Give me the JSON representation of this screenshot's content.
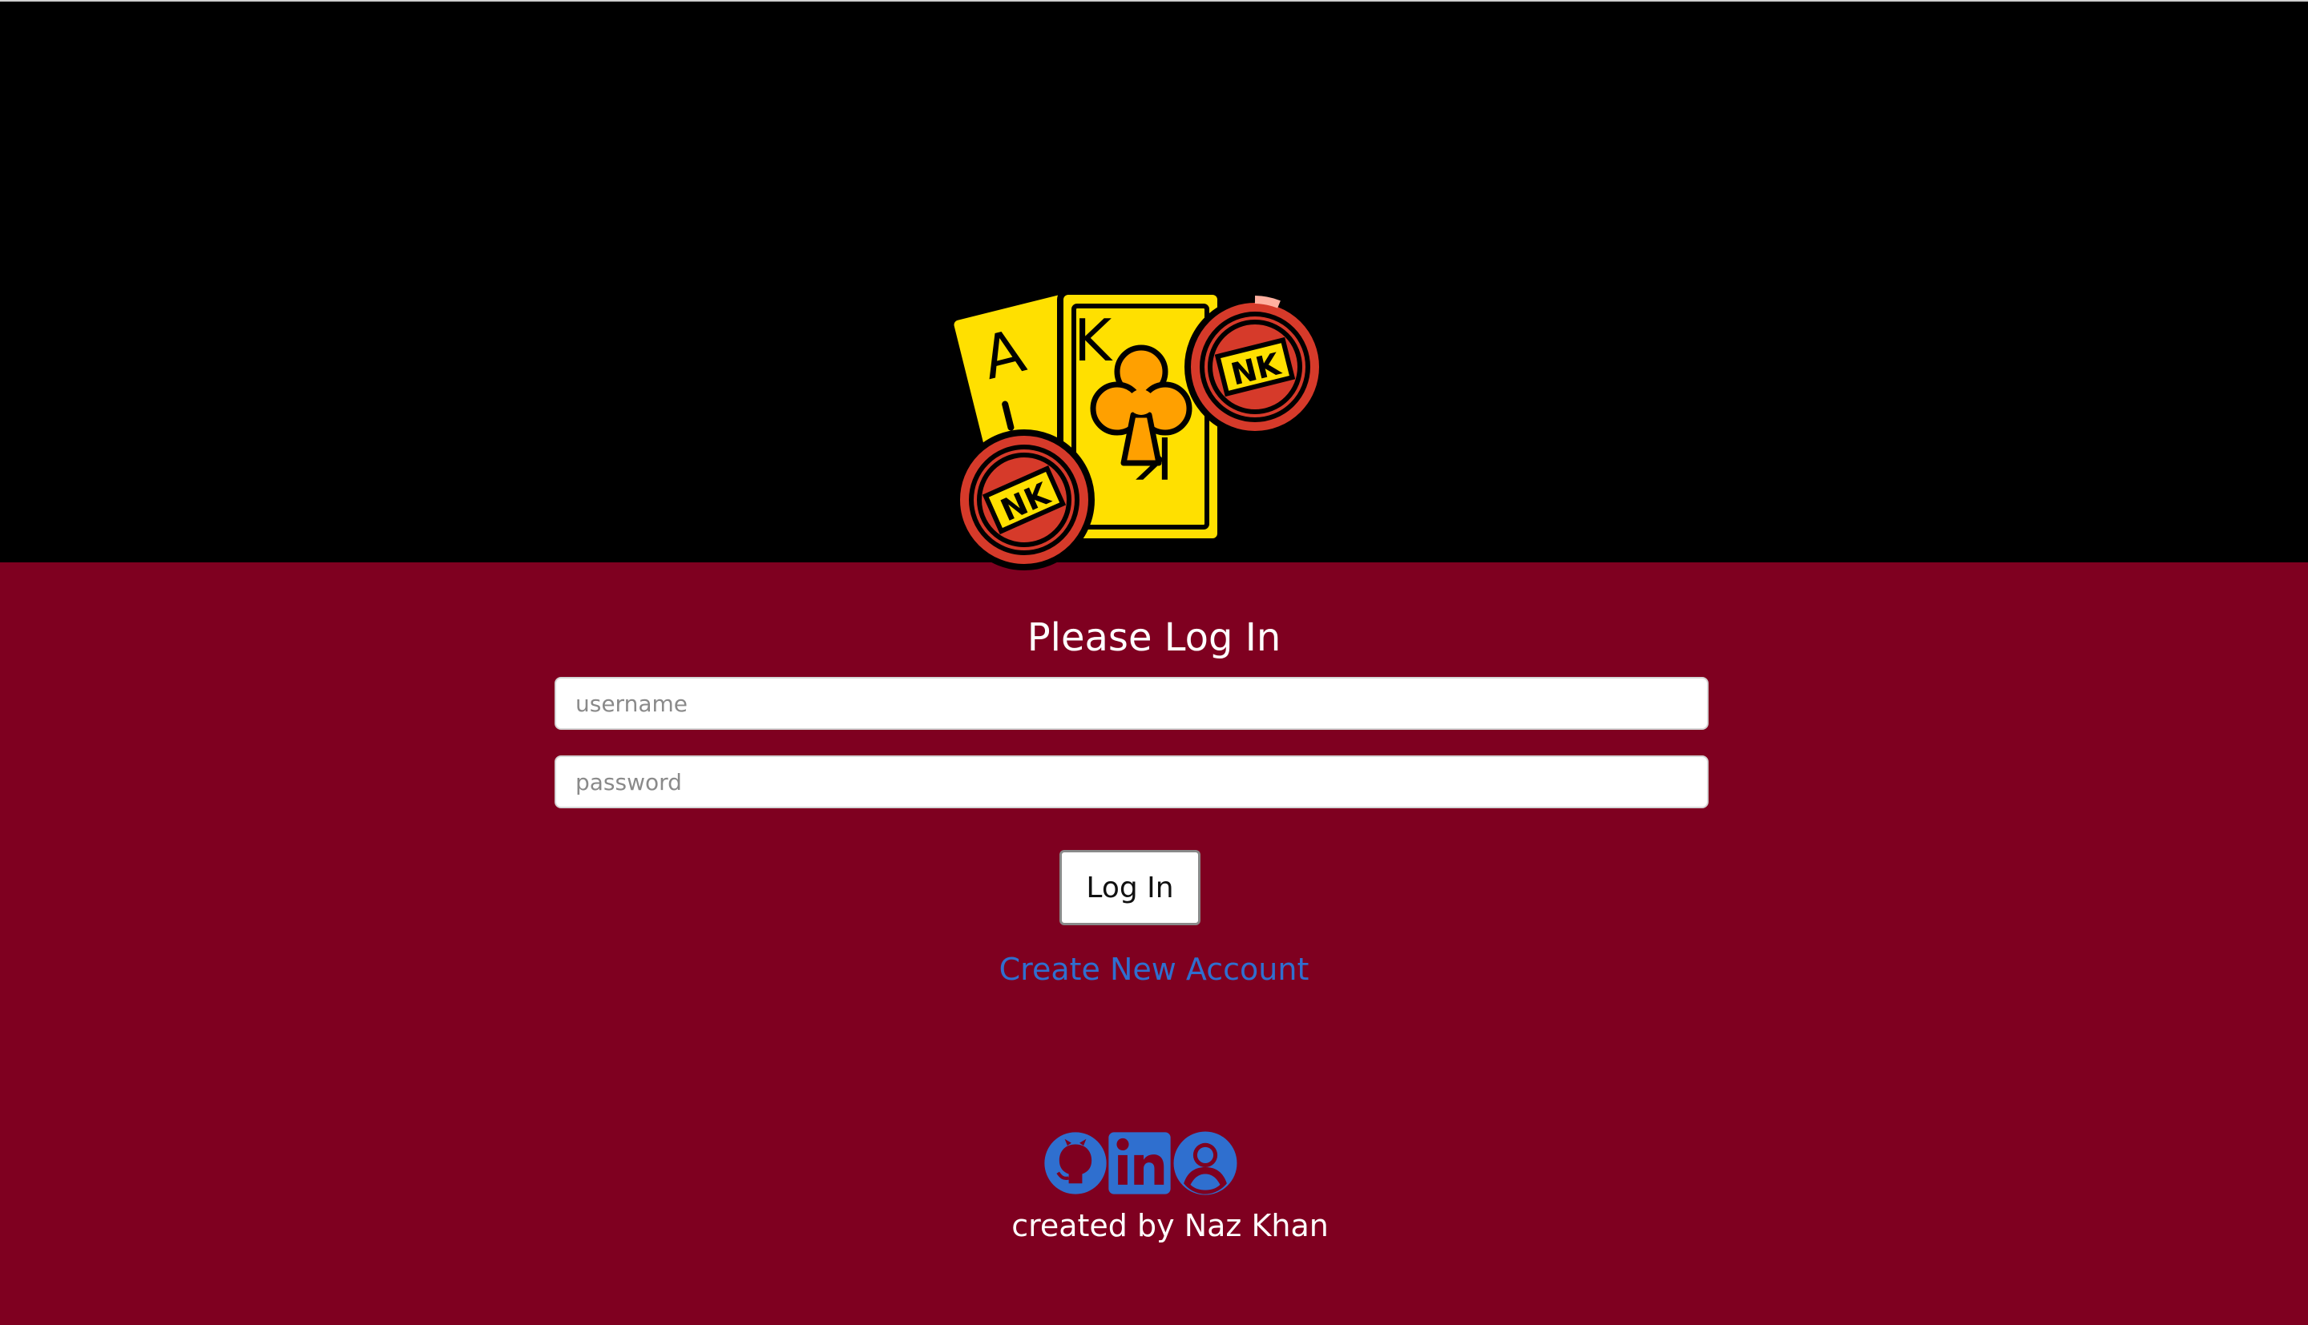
{
  "colors": {
    "top_background": "#000000",
    "bottom_background": "#7f0020",
    "link": "#2f6fcf",
    "icon": "#2f6fcf",
    "card_yellow": "#ffe000",
    "chip_red": "#d63a2a"
  },
  "logo": {
    "name": "playing-cards-chips-logo",
    "card_back_letter": "A",
    "card_front_letter": "K",
    "chip_text": "NK"
  },
  "login": {
    "title": "Please Log In",
    "username_placeholder": "username",
    "username_value": "",
    "password_placeholder": "password",
    "password_value": "",
    "submit_label": "Log In",
    "create_account_label": "Create New Account"
  },
  "footer": {
    "icons": [
      "github-icon",
      "linkedin-icon",
      "profile-icon"
    ],
    "credit": "created by Naz Khan"
  }
}
